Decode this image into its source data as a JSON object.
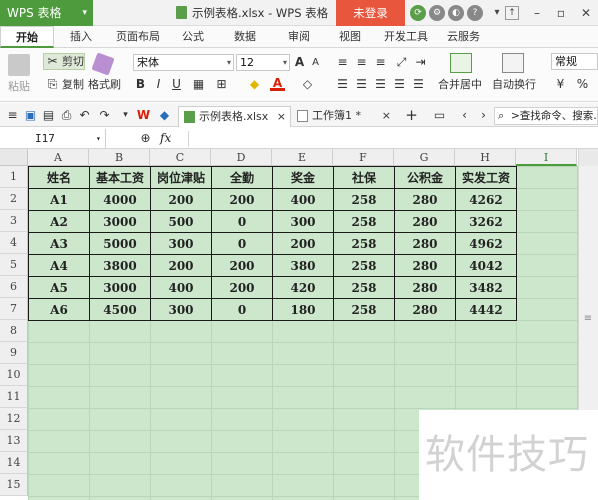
{
  "app": {
    "name": "WPS 表格",
    "caret": "▾"
  },
  "window": {
    "title": "示例表格.xlsx - WPS 表格",
    "login_label": "未登录"
  },
  "colors": {
    "brand": "#4d9b3c",
    "login": "#e8563e",
    "cell_bg": "#cce7cc"
  },
  "tabs": [
    "开始",
    "插入",
    "页面布局",
    "公式",
    "数据",
    "审阅",
    "视图",
    "开发工具",
    "云服务"
  ],
  "ribbon": {
    "paste_label": "粘贴",
    "cut_label": "剪切",
    "copy_label": "复制",
    "format_painter_label": "格式刷",
    "font_name": "宋体",
    "font_size": "12",
    "bold": "B",
    "italic": "I",
    "underline": "U",
    "font_color_label": "A",
    "merge_center_label": "合并居中",
    "wrap_text_label": "自动换行",
    "number_format": "常规",
    "currency_symbol": "¥"
  },
  "doc_tabs": [
    {
      "label": "示例表格.xlsx",
      "close": "×"
    },
    {
      "label": "工作簿1 *",
      "close": "×"
    }
  ],
  "new_tab_label": "+",
  "search_placeholder": ">查找命令、搜索…",
  "formula_bar": {
    "cell_ref": "I17",
    "fx": "fx",
    "formula": ""
  },
  "sheet": {
    "columns": [
      "A",
      "B",
      "C",
      "D",
      "E",
      "F",
      "G",
      "H",
      "I"
    ],
    "rows": [
      "1",
      "2",
      "3",
      "4",
      "5",
      "6",
      "7",
      "8",
      "9",
      "10",
      "11",
      "12",
      "13",
      "14",
      "15"
    ],
    "table": [
      [
        "姓名",
        "基本工资",
        "岗位津贴",
        "全勤",
        "奖金",
        "社保",
        "公积金",
        "实发工资"
      ],
      [
        "A1",
        "4000",
        "200",
        "200",
        "400",
        "258",
        "280",
        "4262"
      ],
      [
        "A2",
        "3000",
        "500",
        "0",
        "300",
        "258",
        "280",
        "3262"
      ],
      [
        "A3",
        "5000",
        "300",
        "0",
        "200",
        "258",
        "280",
        "4962"
      ],
      [
        "A4",
        "3800",
        "200",
        "200",
        "380",
        "258",
        "280",
        "4042"
      ],
      [
        "A5",
        "3000",
        "400",
        "200",
        "420",
        "258",
        "280",
        "3482"
      ],
      [
        "A6",
        "4500",
        "300",
        "0",
        "180",
        "258",
        "280",
        "4442"
      ]
    ]
  },
  "watermark": "软件技巧"
}
